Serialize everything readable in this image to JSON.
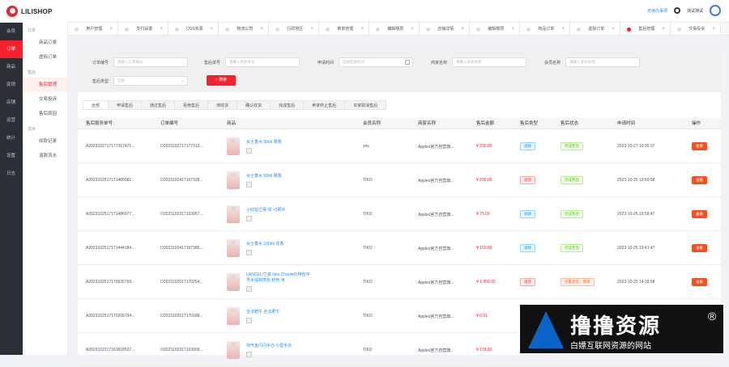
{
  "app": {
    "logo_text": "LILISHOP"
  },
  "header": {
    "message": "无待办事项",
    "user": "测试测试"
  },
  "sidebar_primary": [
    {
      "label": "会员",
      "active": false
    },
    {
      "label": "订单",
      "active": true
    },
    {
      "label": "商品",
      "active": false
    },
    {
      "label": "促销",
      "active": false
    },
    {
      "label": "店铺",
      "active": false
    },
    {
      "label": "运营",
      "active": false
    },
    {
      "label": "统计",
      "active": false
    },
    {
      "label": "设置",
      "active": false
    },
    {
      "label": "日志",
      "active": false
    }
  ],
  "sidebar_secondary": {
    "groups": [
      {
        "title": "订单",
        "items": [
          {
            "label": "商品订单",
            "active": false
          },
          {
            "label": "虚拟订单",
            "active": false
          }
        ]
      },
      {
        "title": "售后",
        "items": [
          {
            "label": "售后管理",
            "active": true
          },
          {
            "label": "交易投诉",
            "active": false
          },
          {
            "label": "售后原因",
            "active": false
          }
        ]
      },
      {
        "title": "流水",
        "items": [
          {
            "label": "收款记录",
            "active": false
          },
          {
            "label": "退款流水",
            "active": false
          }
        ]
      }
    ]
  },
  "tabs": [
    {
      "label": "用户管理",
      "active": false
    },
    {
      "label": "支付设置",
      "active": false
    },
    {
      "label": "OSS资源",
      "active": false
    },
    {
      "label": "物流公司",
      "active": false
    },
    {
      "label": "行政地区",
      "active": false
    },
    {
      "label": "菜单管理",
      "active": false
    },
    {
      "label": "编辑楼层",
      "active": false
    },
    {
      "label": "店铺详情",
      "active": false
    },
    {
      "label": "编辑楼层",
      "active": false
    },
    {
      "label": "商品订单",
      "active": false
    },
    {
      "label": "虚拟订单",
      "active": false
    },
    {
      "label": "售后管理",
      "active": true
    },
    {
      "label": "交易投诉",
      "active": false
    }
  ],
  "filters": {
    "order_no": {
      "label": "订单编号",
      "placeholder": "请输入订单编号"
    },
    "aftersale_no": {
      "label": "售后单号",
      "placeholder": "请输入售后单号"
    },
    "apply_time": {
      "label": "申请时间",
      "placeholder": "选择起始时间"
    },
    "seller": {
      "label": "商家名称",
      "placeholder": "请输入商家名称"
    },
    "member": {
      "label": "会员名称",
      "placeholder": "请输入会员名称"
    },
    "type": {
      "label": "售后类型",
      "value": "全部"
    },
    "search_label": "搜索"
  },
  "status_tabs": [
    "全部",
    "申请售后",
    "通过售后",
    "拒绝售后",
    "待收货",
    "确认收货",
    "完成售后",
    "卖家终止售后",
    "买家取消售后"
  ],
  "columns": [
    "售后服务单号",
    "订单编号",
    "商品",
    "会员名称",
    "商家名称",
    "售后金额",
    "售后类型",
    "售后状态",
    "申请时间",
    "操作"
  ],
  "rows": [
    {
      "sn": "A2023102717177317471...",
      "order": "O2023102717177313...",
      "product": "女士香水 50ml 果香",
      "member": "yes",
      "seller": "Apples官方自营旗...",
      "amount": "¥ 290.00",
      "type": "退款",
      "status": "完成售后",
      "time": "2023-10-27 10:35:37",
      "action": "查看"
    },
    {
      "sn": "A2023102517171489981...",
      "order": "O2023102417167328...",
      "product": "女士香水 50ml 果香",
      "member": "TIKO",
      "seller": "Apples官方自营旗...",
      "amount": "¥ 290.00",
      "type": "退货",
      "status": "完成售后",
      "time": "2023-10-25 19:59:58",
      "action": "查看"
    },
    {
      "sn": "A2023102517171486977...",
      "order": "O2023102317163957...",
      "product": "小红拍立得 绿 +5照片",
      "member": "TIKO",
      "seller": "Apples官方自营旗...",
      "amount": "¥ 75.00",
      "type": "退款",
      "status": "完成售后",
      "time": "2023-10-25 19:58:47",
      "action": "查看"
    },
    {
      "sn": "A2023102517171444184...",
      "order": "O2023102417167385...",
      "product": "女士香水 100ml 花香",
      "member": "TIKO",
      "seller": "Apples官方自营旗...",
      "amount": "¥ 150.00",
      "type": "退款",
      "status": "完成售后",
      "time": "2023-10-25 19:41:47",
      "action": "查看"
    },
    {
      "sn": "A2023102517170626769...",
      "order": "O2023102517170254...",
      "product": "LANCEL/兰姿 Neo Charlie托特包中号手提斜挎包 粉色 米",
      "member": "TIKO",
      "seller": "Apples官方自营旗...",
      "amount": "¥ 1,950.00",
      "type": "退货",
      "status": "买家退货，待审",
      "time": "2023-10-25 14:18:58",
      "action": "查看"
    },
    {
      "sn": "A2023102517170205734...",
      "order": "O2023102517170188...",
      "product": "全法肥牛 全法肥牛",
      "member": "TIKO",
      "seller": "Apples官方自营旗...",
      "amount": "¥ 0.01",
      "type": "",
      "status": "",
      "time": "",
      "action": ""
    },
    {
      "sn": "A2023102317163818537...",
      "order": "O2023102317163909...",
      "product": "帅气金闪闪手办 小型手办",
      "member": "TIKO",
      "seller": "Apples官方自营旗...",
      "amount": "¥ 178.80",
      "type": "",
      "status": "",
      "time": "",
      "action": ""
    }
  ],
  "watermark": {
    "title": "撸撸资源",
    "subtitle": "白嫖互联网资源的网站",
    "mark": "®"
  }
}
